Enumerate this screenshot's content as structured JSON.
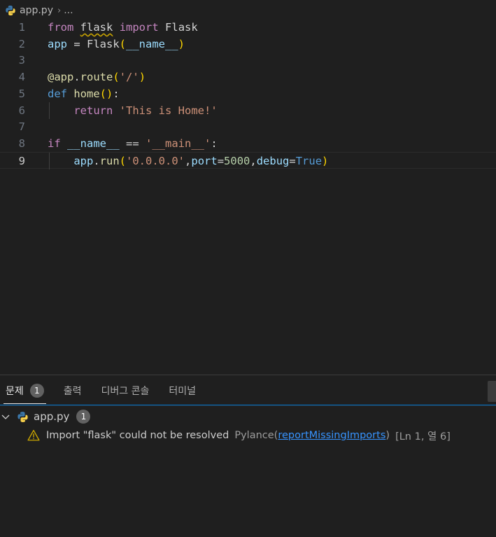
{
  "breadcrumb": {
    "file": "app.py",
    "more": "..."
  },
  "editor": {
    "active_line": 9,
    "lines": [
      {
        "num": "1",
        "tokens": [
          {
            "t": "from",
            "c": "kw-import"
          },
          {
            "t": " ",
            "c": "plain"
          },
          {
            "t": "flask",
            "c": "plain squiggle"
          },
          {
            "t": " ",
            "c": "plain"
          },
          {
            "t": "import",
            "c": "kw-import"
          },
          {
            "t": " ",
            "c": "plain"
          },
          {
            "t": "Flask",
            "c": "plain"
          }
        ]
      },
      {
        "num": "2",
        "tokens": [
          {
            "t": "app",
            "c": "var"
          },
          {
            "t": " = ",
            "c": "plain"
          },
          {
            "t": "Flask",
            "c": "plain"
          },
          {
            "t": "(",
            "c": "paren1"
          },
          {
            "t": "__name__",
            "c": "var"
          },
          {
            "t": ")",
            "c": "paren1"
          }
        ]
      },
      {
        "num": "3",
        "tokens": []
      },
      {
        "num": "4",
        "tokens": [
          {
            "t": "@app",
            "c": "fn"
          },
          {
            "t": ".",
            "c": "plain"
          },
          {
            "t": "route",
            "c": "fn"
          },
          {
            "t": "(",
            "c": "paren1"
          },
          {
            "t": "'/'",
            "c": "str"
          },
          {
            "t": ")",
            "c": "paren1"
          }
        ]
      },
      {
        "num": "5",
        "tokens": [
          {
            "t": "def",
            "c": "kw-blue"
          },
          {
            "t": " ",
            "c": "plain"
          },
          {
            "t": "home",
            "c": "fn"
          },
          {
            "t": "()",
            "c": "paren1"
          },
          {
            "t": ":",
            "c": "plain"
          }
        ]
      },
      {
        "num": "6",
        "indent": true,
        "tokens": [
          {
            "t": "    ",
            "c": "plain"
          },
          {
            "t": "return",
            "c": "kw-import"
          },
          {
            "t": " ",
            "c": "plain"
          },
          {
            "t": "'This is Home!'",
            "c": "str"
          }
        ]
      },
      {
        "num": "7",
        "tokens": []
      },
      {
        "num": "8",
        "tokens": [
          {
            "t": "if",
            "c": "kw-import"
          },
          {
            "t": " ",
            "c": "plain"
          },
          {
            "t": "__name__",
            "c": "var"
          },
          {
            "t": " == ",
            "c": "plain"
          },
          {
            "t": "'__main__'",
            "c": "str"
          },
          {
            "t": ":",
            "c": "plain"
          }
        ]
      },
      {
        "num": "9",
        "indent": true,
        "tokens": [
          {
            "t": "    ",
            "c": "plain"
          },
          {
            "t": "app",
            "c": "var"
          },
          {
            "t": ".",
            "c": "plain"
          },
          {
            "t": "run",
            "c": "fn"
          },
          {
            "t": "(",
            "c": "paren1"
          },
          {
            "t": "'0.0.0.0'",
            "c": "str"
          },
          {
            "t": ",",
            "c": "plain"
          },
          {
            "t": "port",
            "c": "var"
          },
          {
            "t": "=",
            "c": "plain"
          },
          {
            "t": "5000",
            "c": "num"
          },
          {
            "t": ",",
            "c": "plain"
          },
          {
            "t": "debug",
            "c": "var"
          },
          {
            "t": "=",
            "c": "plain"
          },
          {
            "t": "True",
            "c": "kw-blue"
          },
          {
            "t": ")",
            "c": "paren1"
          }
        ]
      }
    ]
  },
  "panel": {
    "tabs": [
      {
        "label": "문제",
        "badge": "1",
        "active": true
      },
      {
        "label": "출력"
      },
      {
        "label": "디버그 콘솔"
      },
      {
        "label": "터미널"
      }
    ],
    "problems": {
      "file": "app.py",
      "count": "1",
      "items": [
        {
          "message": "Import \"flask\" could not be resolved",
          "source": "Pylance",
          "code_open": "(",
          "code": "reportMissingImports",
          "code_close": ")",
          "location": "[Ln 1, 열 6]"
        }
      ]
    }
  },
  "colors": {
    "accent": "#0078d4",
    "warning": "#cca700",
    "link": "#3794ff"
  }
}
